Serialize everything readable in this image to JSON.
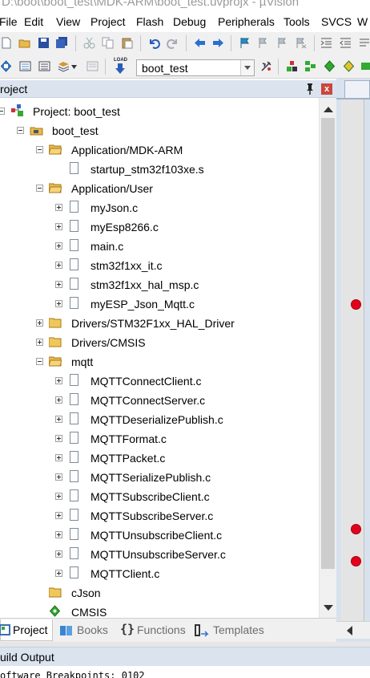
{
  "window": {
    "title": "D:\\boot\\boot_test\\MDK-ARM\\boot_test.uvprojx - µVision"
  },
  "menu": [
    "File",
    "Edit",
    "View",
    "Project",
    "Flash",
    "Debug",
    "Peripherals",
    "Tools",
    "SVCS",
    "W"
  ],
  "toolbar": {
    "target_value": "boot_test",
    "load_label": "LOAD"
  },
  "project_pane": {
    "title": "roject",
    "close_label": "x",
    "tree": [
      {
        "label": "Project: boot_test"
      },
      {
        "label": "boot_test"
      },
      {
        "label": "Application/MDK-ARM"
      },
      {
        "label": "startup_stm32f103xe.s"
      },
      {
        "label": "Application/User"
      },
      {
        "label": "myJson.c"
      },
      {
        "label": "myEsp8266.c"
      },
      {
        "label": "main.c"
      },
      {
        "label": "stm32f1xx_it.c"
      },
      {
        "label": "stm32f1xx_hal_msp.c"
      },
      {
        "label": "myESP_Json_Mqtt.c"
      },
      {
        "label": "Drivers/STM32F1xx_HAL_Driver"
      },
      {
        "label": "Drivers/CMSIS"
      },
      {
        "label": "mqtt"
      },
      {
        "label": "MQTTConnectClient.c"
      },
      {
        "label": "MQTTConnectServer.c"
      },
      {
        "label": "MQTTDeserializePublish.c"
      },
      {
        "label": "MQTTFormat.c"
      },
      {
        "label": "MQTTPacket.c"
      },
      {
        "label": "MQTTSerializePublish.c"
      },
      {
        "label": "MQTTSubscribeClient.c"
      },
      {
        "label": "MQTTSubscribeServer.c"
      },
      {
        "label": "MQTTUnsubscribeClient.c"
      },
      {
        "label": "MQTTUnsubscribeServer.c"
      },
      {
        "label": "MQTTClient.c"
      },
      {
        "label": "cJson"
      },
      {
        "label": "CMSIS"
      }
    ],
    "tabs": [
      {
        "label": "Project"
      },
      {
        "label": "Books"
      },
      {
        "label": "Functions"
      },
      {
        "label": "Templates"
      }
    ]
  },
  "build_output": {
    "title": "uild Output",
    "line": "oftware Breakpoints: 0102"
  },
  "colors": {
    "breakpoint": "#e3001b",
    "pane_header": "#dbe3ef"
  }
}
